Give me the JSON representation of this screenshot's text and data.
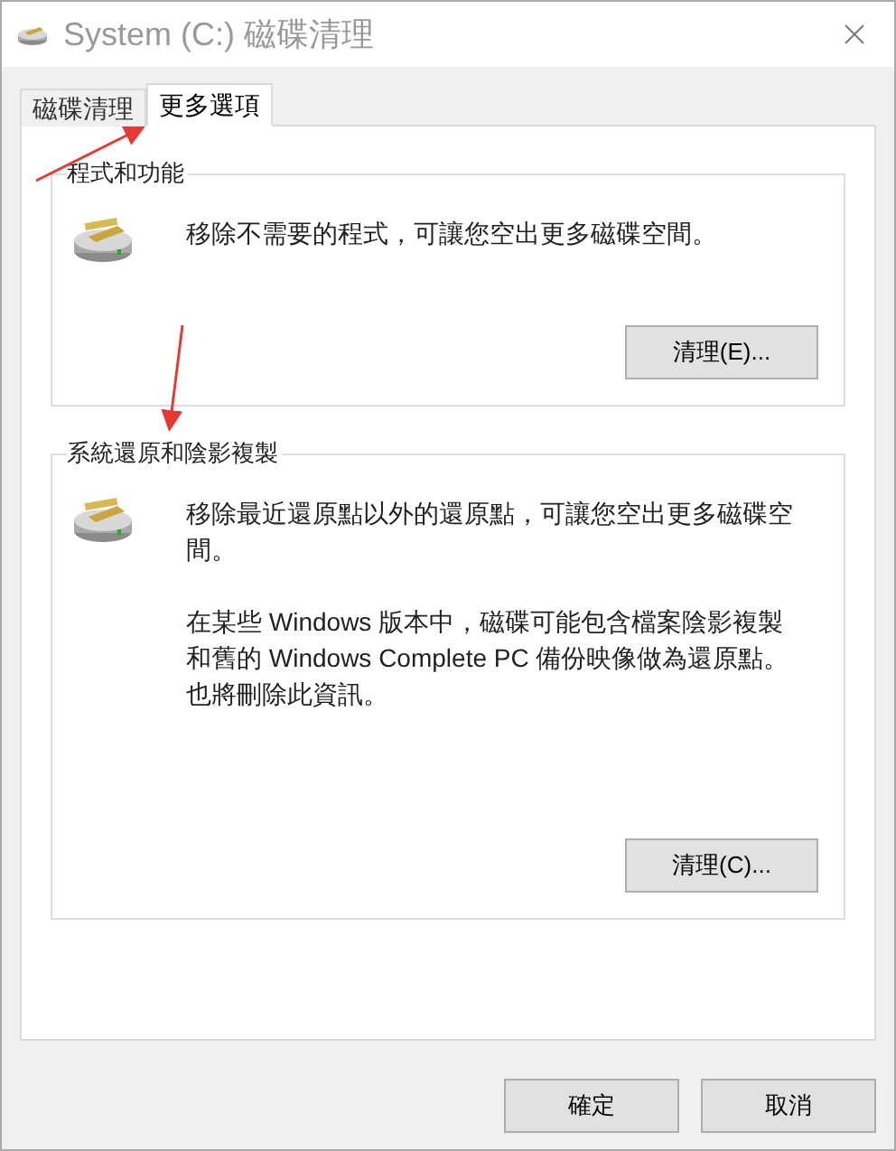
{
  "window": {
    "title": "System  (C:) 磁碟清理"
  },
  "tabs": [
    {
      "label": "磁碟清理",
      "selected": false
    },
    {
      "label": "更多選項",
      "selected": true
    }
  ],
  "groups": [
    {
      "title": "程式和功能",
      "paragraphs": [
        "移除不需要的程式，可讓您空出更多磁碟空間。"
      ],
      "button": "清理(E)..."
    },
    {
      "title": "系統還原和陰影複製",
      "paragraphs": [
        "移除最近還原點以外的還原點，可讓您空出更多磁碟空間。",
        "在某些 Windows 版本中，磁碟可能包含檔案陰影複製和舊的 Windows Complete PC 備份映像做為還原點。也將刪除此資訊。"
      ],
      "button": "清理(C)..."
    }
  ],
  "buttons": [
    "確定",
    "取消"
  ]
}
